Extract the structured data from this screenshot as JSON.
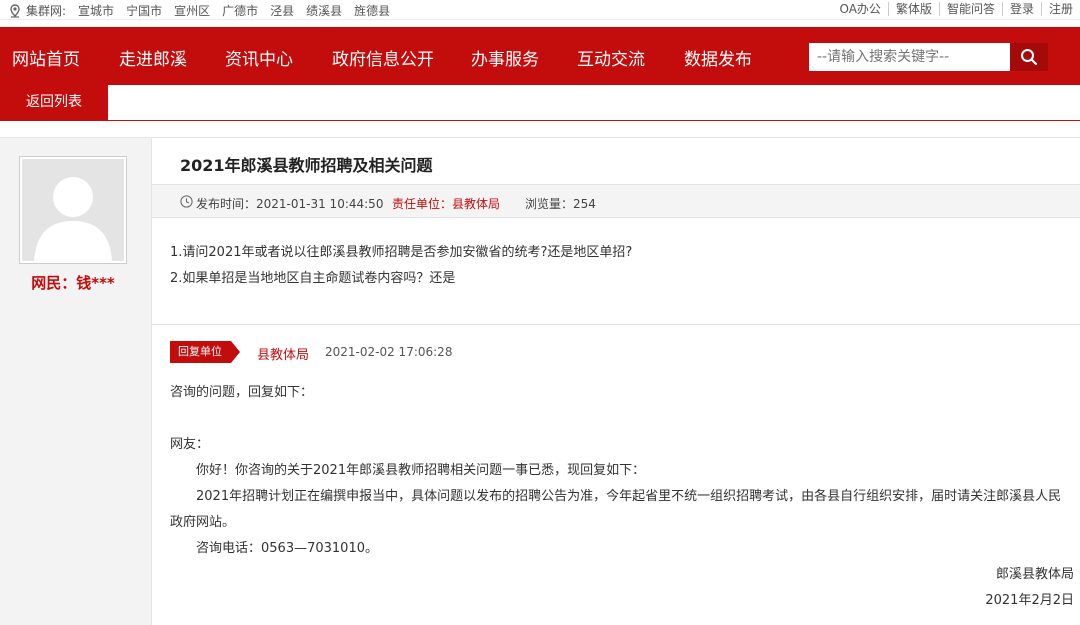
{
  "topbar": {
    "prefix": "集群网:",
    "cities": [
      "宣城市",
      "宁国市",
      "宣州区",
      "广德市",
      "泾县",
      "绩溪县",
      "旌德县"
    ],
    "links": [
      "OA办公",
      "繁体版",
      "智能问答",
      "登录",
      "注册"
    ]
  },
  "nav": {
    "items": [
      "网站首页",
      "走进郎溪",
      "资讯中心",
      "政府信息公开",
      "办事服务",
      "互动交流",
      "数据发布"
    ],
    "search_placeholder": "--请输入搜索关键字--"
  },
  "subbar": {
    "back_label": "返回列表"
  },
  "user": {
    "name": "网民：钱***"
  },
  "article": {
    "title": "2021年郎溪县教师招聘及相关问题",
    "pub_time": "发布时间：2021-01-31 10:44:50",
    "dept": "责任单位：县教体局",
    "views": "浏览量：254",
    "question_lines": [
      "1.请问2021年或者说以往郎溪县教师招聘是否参加安徽省的统考?还是地区单招?",
      "2.如果单招是当地地区自主命题试卷内容吗？还是"
    ]
  },
  "reply": {
    "badge": "回复单位",
    "unit": "县教体局",
    "time": "2021-02-02 17:06:28",
    "intro": "咨询的问题，回复如下：",
    "greeting": "网友：",
    "para1": "你好！你咨询的关于2021年郎溪县教师招聘相关问题一事已悉，现回复如下：",
    "para2": "2021年招聘计划正在编撰申报当中，具体问题以发布的招聘公告为准，今年起省里不统一组织招聘考试，由各县自行组织安排，届时请关注郎溪县人民政府网站。",
    "phone": "咨询电话：0563—7031010。",
    "sign_unit": "郎溪县教体局",
    "sign_date": "2021年2月2日"
  },
  "colors": {
    "brand_red": "#c30d0d"
  }
}
